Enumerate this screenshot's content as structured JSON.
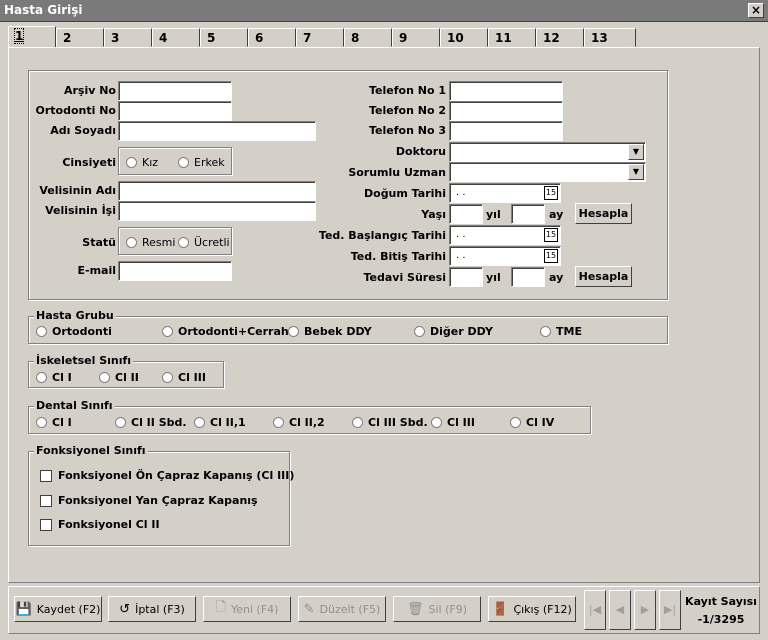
{
  "window": {
    "title": "Hasta Girişi",
    "close": "×"
  },
  "tabs": [
    "1",
    "2",
    "3",
    "4",
    "5",
    "6",
    "7",
    "8",
    "9",
    "10",
    "11",
    "12",
    "13"
  ],
  "fields": {
    "arsiv_no": "Arşiv No",
    "ortodonti_no": "Ortodonti No",
    "adi_soyadi": "Adı Soyadı",
    "cinsiyeti": "Cinsiyeti",
    "kiz": "Kız",
    "erkek": "Erkek",
    "velisinin_adi": "Velisinin Adı",
    "velisinin_isi": "Velisinin İşi",
    "statu": "Statü",
    "resmi": "Resmi",
    "ucretli": "Ücretli",
    "email": "E-mail",
    "telefon1": "Telefon No 1",
    "telefon2": "Telefon No 2",
    "telefon3": "Telefon No 3",
    "doktoru": "Doktoru",
    "sorumlu_uzman": "Sorumlu Uzman",
    "dogum_tarihi": "Doğum Tarihi",
    "yasi": "Yaşı",
    "yil": "yıl",
    "ay": "ay",
    "hesapla": "Hesapla",
    "ted_baslangic": "Ted. Başlangıç Tarihi",
    "ted_bitis": "Ted. Bitiş Tarihi",
    "tedavi_suresi": "Tedavi Süresi",
    "date_placeholder": ". .",
    "cal_icon": "15"
  },
  "hasta_grubu": {
    "title": "Hasta Grubu",
    "options": [
      "Ortodonti",
      "Ortodonti+Cerrahi",
      "Bebek DDY",
      "Diğer DDY",
      "TME"
    ]
  },
  "iskeletsel": {
    "title": "İskeletsel Sınıfı",
    "options": [
      "Cl I",
      "Cl II",
      "Cl III"
    ]
  },
  "dental": {
    "title": "Dental Sınıfı",
    "options": [
      "Cl I",
      "Cl II Sbd.",
      "Cl II,1",
      "Cl II,2",
      "Cl III Sbd.",
      "Cl III",
      "Cl IV"
    ]
  },
  "fonksiyonel": {
    "title": "Fonksiyonel Sınıfı",
    "options": [
      "Fonksiyonel Ön Çapraz Kapanış (Cl III)",
      "Fonksiyonel Yan Çapraz Kapanış",
      "Fonksiyonel Cl II"
    ]
  },
  "buttons": {
    "kaydet": "Kaydet (F2)",
    "iptal": "İptal (F3)",
    "yeni": "Yeni (F4)",
    "duzelt": "Düzelt (F5)",
    "sil": "Sil (F9)",
    "cikis": "Çıkış (F12)"
  },
  "nav": {
    "first": "|◀",
    "prev": "◀",
    "next": "▶",
    "last": "▶|"
  },
  "record": {
    "label": "Kayıt Sayısı",
    "value": "-1/3295"
  }
}
